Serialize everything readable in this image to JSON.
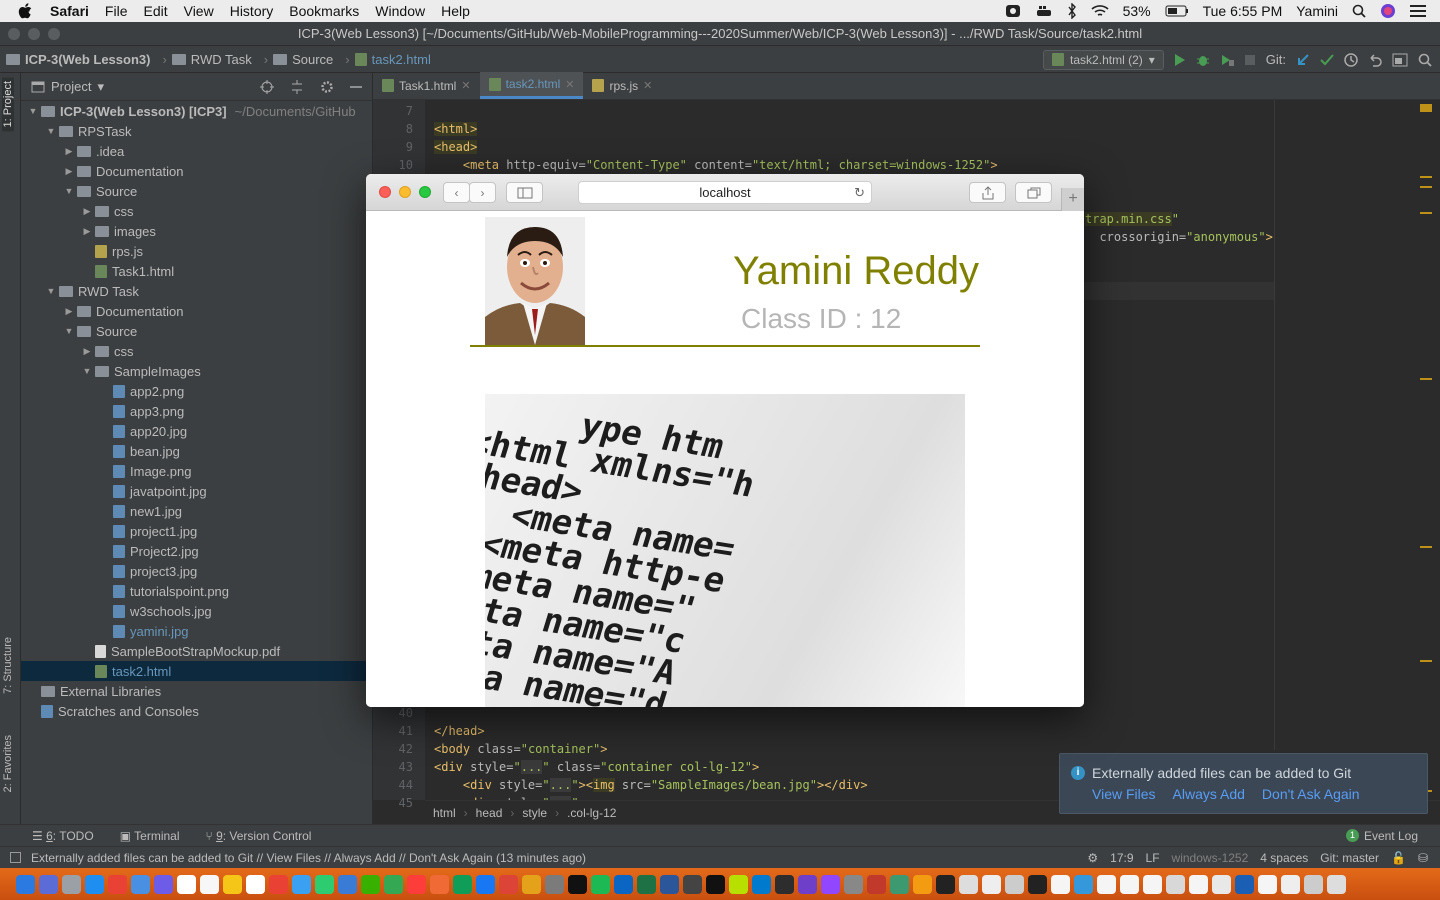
{
  "menubar": {
    "app": "Safari",
    "items": [
      "File",
      "Edit",
      "View",
      "History",
      "Bookmarks",
      "Window",
      "Help"
    ],
    "battery": "53%",
    "clock": "Tue 6:55 PM",
    "user": "Yamini"
  },
  "ide": {
    "window_title": "ICP-3(Web Lesson3) [~/Documents/GitHub/Web-MobileProgramming---2020Summer/Web/ICP-3(Web Lesson3)] - .../RWD Task/Source/task2.html",
    "nav_crumbs": [
      "ICP-3(Web Lesson3)",
      "RWD Task",
      "Source",
      "task2.html"
    ],
    "run_config": "task2.html (2)",
    "git_label": "Git:",
    "project_label": "Project",
    "tabs": [
      {
        "label": "Task1.html",
        "active": false
      },
      {
        "label": "task2.html",
        "active": true
      },
      {
        "label": "rps.js",
        "active": false
      }
    ],
    "tree": [
      {
        "depth": 0,
        "arrow": "▼",
        "type": "folder",
        "label": "ICP-3(Web Lesson3) [ICP3]",
        "suffix": "~/Documents/GitHub",
        "bold": true
      },
      {
        "depth": 1,
        "arrow": "▼",
        "type": "folder",
        "label": "RPSTask"
      },
      {
        "depth": 2,
        "arrow": "▶",
        "type": "folder",
        "label": ".idea"
      },
      {
        "depth": 2,
        "arrow": "▶",
        "type": "folder",
        "label": "Documentation"
      },
      {
        "depth": 2,
        "arrow": "▼",
        "type": "folder",
        "label": "Source"
      },
      {
        "depth": 3,
        "arrow": "▶",
        "type": "folder",
        "label": "css"
      },
      {
        "depth": 3,
        "arrow": "▶",
        "type": "folder",
        "label": "images"
      },
      {
        "depth": 3,
        "arrow": "",
        "type": "js",
        "label": "rps.js"
      },
      {
        "depth": 3,
        "arrow": "",
        "type": "html",
        "label": "Task1.html"
      },
      {
        "depth": 1,
        "arrow": "▼",
        "type": "folder",
        "label": "RWD Task"
      },
      {
        "depth": 2,
        "arrow": "▶",
        "type": "folder",
        "label": "Documentation"
      },
      {
        "depth": 2,
        "arrow": "▼",
        "type": "folder",
        "label": "Source"
      },
      {
        "depth": 3,
        "arrow": "▶",
        "type": "folder",
        "label": "css"
      },
      {
        "depth": 3,
        "arrow": "▼",
        "type": "folder",
        "label": "SampleImages"
      },
      {
        "depth": 4,
        "arrow": "",
        "type": "img",
        "label": "app2.png"
      },
      {
        "depth": 4,
        "arrow": "",
        "type": "img",
        "label": "app3.png"
      },
      {
        "depth": 4,
        "arrow": "",
        "type": "img",
        "label": "app20.jpg"
      },
      {
        "depth": 4,
        "arrow": "",
        "type": "img",
        "label": "bean.jpg"
      },
      {
        "depth": 4,
        "arrow": "",
        "type": "img",
        "label": "Image.png"
      },
      {
        "depth": 4,
        "arrow": "",
        "type": "img",
        "label": "javatpoint.jpg"
      },
      {
        "depth": 4,
        "arrow": "",
        "type": "img",
        "label": "new1.jpg"
      },
      {
        "depth": 4,
        "arrow": "",
        "type": "img",
        "label": "project1.jpg"
      },
      {
        "depth": 4,
        "arrow": "",
        "type": "img",
        "label": "Project2.jpg"
      },
      {
        "depth": 4,
        "arrow": "",
        "type": "img",
        "label": "project3.jpg"
      },
      {
        "depth": 4,
        "arrow": "",
        "type": "img",
        "label": "tutorialspoint.png"
      },
      {
        "depth": 4,
        "arrow": "",
        "type": "img",
        "label": "w3schools.jpg"
      },
      {
        "depth": 4,
        "arrow": "",
        "type": "img",
        "label": "yamini.jpg",
        "blue": true
      },
      {
        "depth": 3,
        "arrow": "",
        "type": "pdf",
        "label": "SampleBootStrapMockup.pdf"
      },
      {
        "depth": 3,
        "arrow": "",
        "type": "html",
        "label": "task2.html",
        "selected": true
      },
      {
        "depth": 0,
        "arrow": "",
        "type": "lib",
        "label": "External Libraries"
      },
      {
        "depth": 0,
        "arrow": "",
        "type": "scratch",
        "label": "Scratches and Consoles"
      }
    ],
    "code_top": [
      {
        "n": "7",
        "html": ""
      },
      {
        "n": "8",
        "html": "<span class='tag hl'>&lt;html&gt;</span>"
      },
      {
        "n": "9",
        "html": "<span class='tag hl'>&lt;head&gt;</span>"
      },
      {
        "n": "10",
        "html": "    <span class='tag'>&lt;meta </span><span class='attr'>http-equiv=</span><span class='str'>\"Content-Type\"</span><span class='attr'> content=</span><span class='str'>\"text/html; charset=windows-1252\"</span><span class='tag'>&gt;</span>"
      }
    ],
    "code_right": [
      {
        "html": "<span class='str hl'>trap.min.css</span><span class='str'>\"</span>"
      },
      {
        "html": "  <span class='attr'>crossorigin=</span><span class='str'>\"anonymous\"</span><span class='tag'>&gt;</span>"
      }
    ],
    "code_bottom": [
      {
        "n": "40",
        "html": ""
      },
      {
        "n": "41",
        "html": "<span class='tag'>&lt;/head&gt;</span>"
      },
      {
        "n": "42",
        "html": "<span class='tag'>&lt;body </span><span class='attr'>class=</span><span class='str'>\"container\"</span><span class='tag'>&gt;</span>"
      },
      {
        "n": "43",
        "html": "<span class='tag'>&lt;div </span><span class='attr'>style=</span><span class='str'>\"<span style='background:#3a3a3a'>...</span>\"</span><span class='attr'> class=</span><span class='str'>\"container col-lg-12\"</span><span class='tag'>&gt;</span>"
      },
      {
        "n": "44",
        "html": "    <span class='tag'>&lt;div </span><span class='attr'>style=</span><span class='str'>\"<span style='background:#3a3a3a'>...</span>\"</span><span class='tag'>&gt;&lt;</span><span class='tag hl'>img</span><span class='attr'> src=</span><span class='str'>\"SampleImages/bean.jpg\"</span><span class='tag'>&gt;&lt;/div&gt;</span>"
      },
      {
        "n": "45",
        "html": "    <span class='tag'>&lt;div </span><span class='attr'>style=</span><span class='str'>\"<span style='background:#3a3a3a'>...</span>\"</span><span class='tag'>&gt;</span>"
      }
    ],
    "editor_crumbs": [
      "html",
      "head",
      "style",
      ".col-lg-12"
    ],
    "tool_windows": [
      {
        "key": "6",
        "label": ": TODO"
      },
      {
        "key": "",
        "label": "Terminal"
      },
      {
        "key": "9",
        "label": ": Version Control"
      }
    ],
    "event_log": "Event Log",
    "event_log_count": "1",
    "status_message": "Externally added files can be added to Git // View Files // Always Add // Don't Ask Again (13 minutes ago)",
    "status": {
      "pos": "17:9",
      "lf": "LF",
      "encoding": "windows-1252",
      "indent": "4 spaces",
      "git": "Git: master"
    },
    "side_tabs": {
      "project": "1: Project",
      "structure": "7: Structure",
      "favorites": "2: Favorites"
    }
  },
  "notification": {
    "text": "Externally added files can be added to Git",
    "links": [
      "View Files",
      "Always Add",
      "Don't Ask Again"
    ]
  },
  "safari": {
    "url": "localhost",
    "page": {
      "name": "Yamini Reddy",
      "class_id": "Class ID : 12",
      "image_code_lines": [
        "     ype htm",
        "<html xmlns=\"h",
        "<head>",
        "   <meta name=",
        "  <meta http-e",
        " <meta name=\"",
        "<meta name=\"c",
        "<meta name=\"A",
        "<meta name=\"d"
      ]
    }
  },
  "colors": {
    "accent_olive": "#808000",
    "ide_bg": "#2b2b2b",
    "panel_bg": "#3c3f41",
    "link": "#589df6",
    "dock": "#e46a1a"
  },
  "dock_colors": [
    "#2a7ae2",
    "#5b6cd6",
    "#9aa0a6",
    "#1f8ef1",
    "#e94235",
    "#4a90e2",
    "#6c5ce7",
    "#ffffff",
    "#f7f7f7",
    "#f5c518",
    "#ffffff",
    "#e94235",
    "#3aa1f2",
    "#2ecc71",
    "#3a7bd5",
    "#38b000",
    "#34a853",
    "#fc3d39",
    "#f06a35",
    "#0f9d58",
    "#1877f2",
    "#db4437",
    "#e3a21a",
    "#7b7b7b",
    "#111111",
    "#1db954",
    "#0a66c2",
    "#1e7145",
    "#2b579a",
    "#444444",
    "#111111",
    "#b7e000",
    "#007acc",
    "#2d2d2d",
    "#6e40c9",
    "#9146ff",
    "#888888",
    "#c0392b",
    "#3d9970",
    "#f39c12",
    "#222222",
    "#dddddd",
    "#eeeeee",
    "#cccccc",
    "#222222",
    "#f5f5f5",
    "#3498db",
    "#f5f5f5",
    "#f5f5f5",
    "#f5f5f5",
    "#d8d8d8",
    "#f5f5f5",
    "#e8e8e8",
    "#1a5fb4",
    "#f5f5f5",
    "#eeeeee",
    "#cccccc",
    "#dddddd"
  ]
}
